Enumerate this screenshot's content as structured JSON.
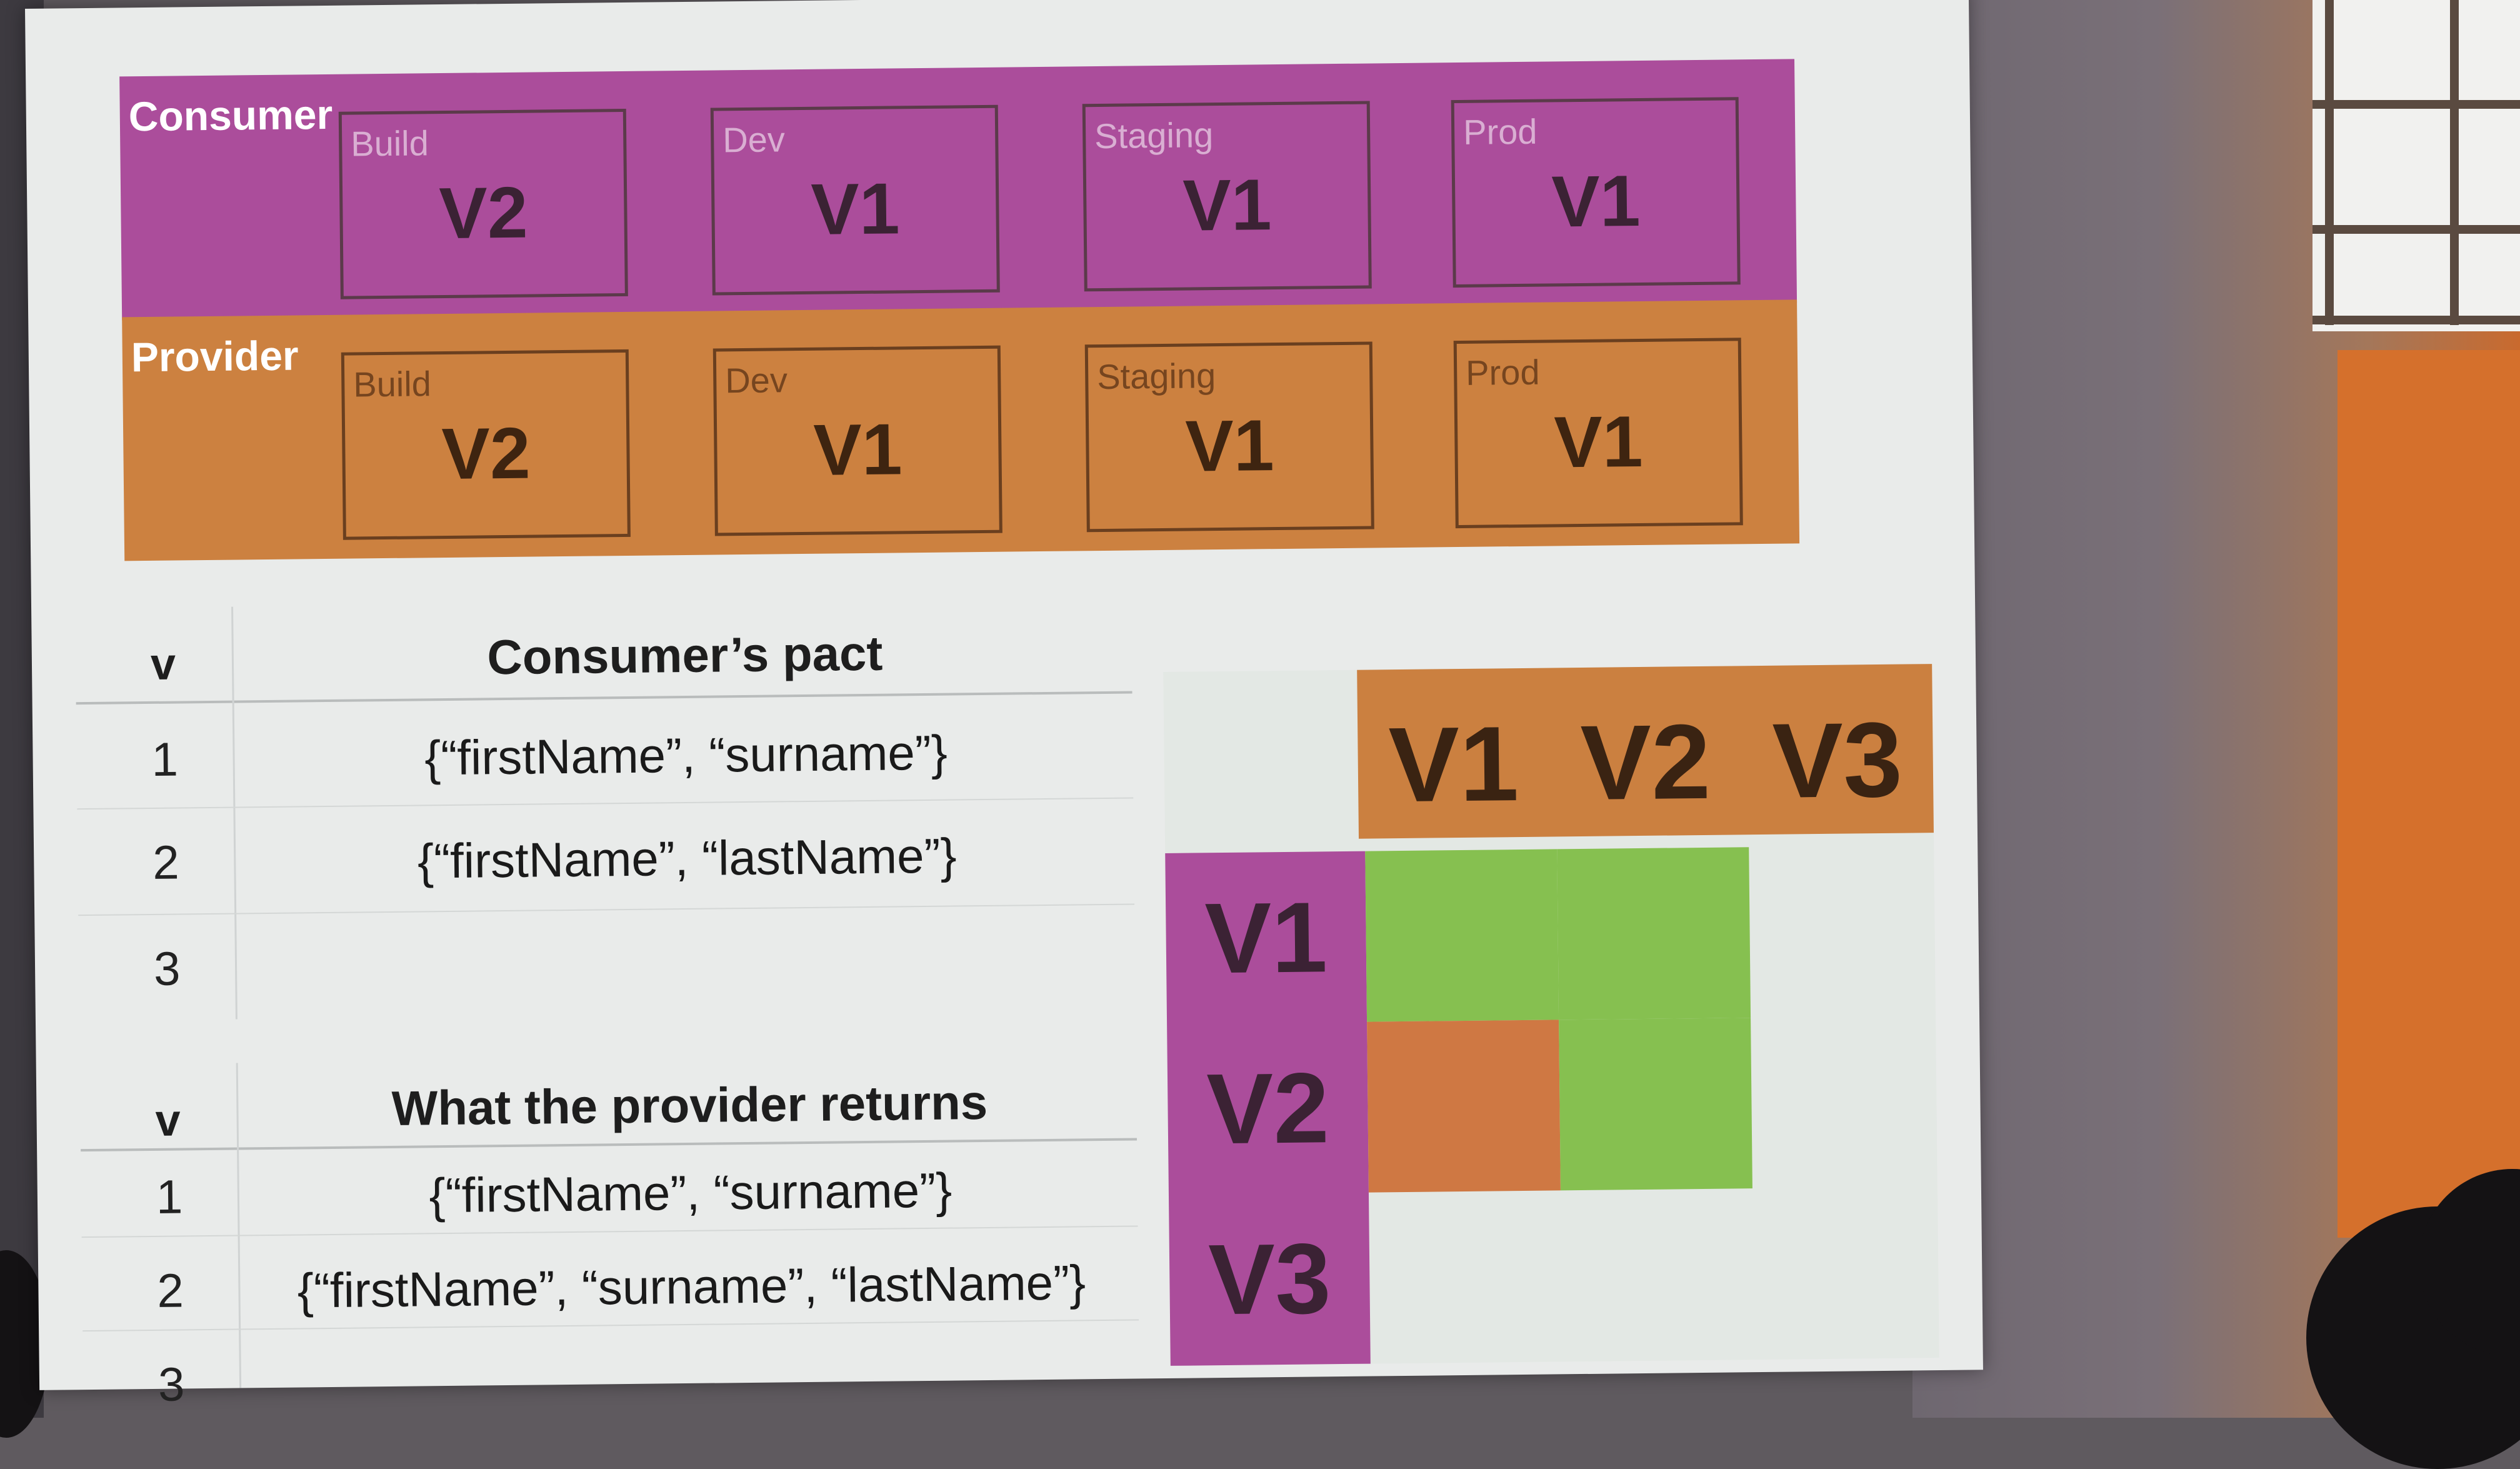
{
  "colors": {
    "consumer_band": "#ab4d9b",
    "provider_band": "#cc8140",
    "compatible": "#86c050",
    "incompatible": "#cf7843"
  },
  "pipeline": {
    "consumer": {
      "label": "Consumer",
      "stages": [
        {
          "name": "Build",
          "version": "V2"
        },
        {
          "name": "Dev",
          "version": "V1"
        },
        {
          "name": "Staging",
          "version": "V1"
        },
        {
          "name": "Prod",
          "version": "V1"
        }
      ]
    },
    "provider": {
      "label": "Provider",
      "stages": [
        {
          "name": "Build",
          "version": "V2"
        },
        {
          "name": "Dev",
          "version": "V1"
        },
        {
          "name": "Staging",
          "version": "V1"
        },
        {
          "name": "Prod",
          "version": "V1"
        }
      ]
    }
  },
  "consumer_pact": {
    "col_v": "v",
    "title": "Consumer’s pact",
    "rows": [
      {
        "v": "1",
        "value": "{“firstName”, “surname”}"
      },
      {
        "v": "2",
        "value": "{“firstName”, “lastName”}"
      },
      {
        "v": "3",
        "value": ""
      }
    ]
  },
  "provider_returns": {
    "col_v": "v",
    "title": "What the provider returns",
    "rows": [
      {
        "v": "1",
        "value": "{“firstName”, “surname”}"
      },
      {
        "v": "2",
        "value": "{“firstName”, “surname”, “lastName”}"
      },
      {
        "v": "3",
        "value": ""
      }
    ]
  },
  "matrix": {
    "columns": [
      "V1",
      "V2",
      "V3"
    ],
    "rows": [
      "V1",
      "V2",
      "V3"
    ],
    "cells": [
      [
        "compatible",
        "compatible",
        "none"
      ],
      [
        "incompatible",
        "compatible",
        "none"
      ],
      [
        "none",
        "none",
        "none"
      ]
    ]
  }
}
